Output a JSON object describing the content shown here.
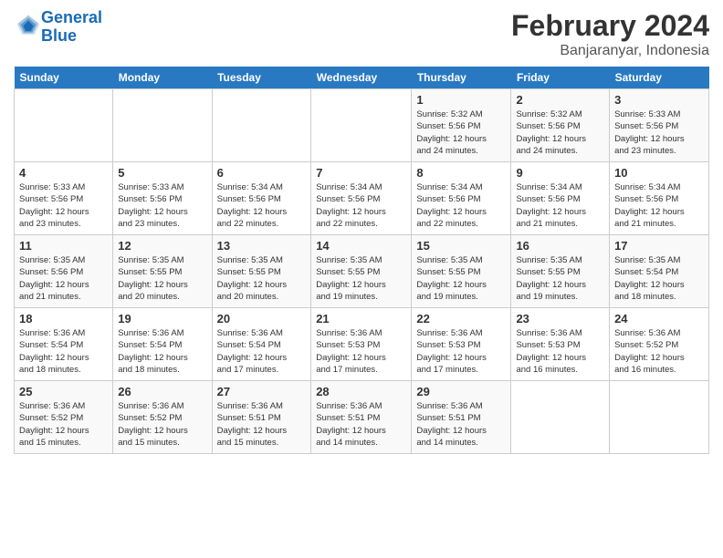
{
  "logo": {
    "text1": "General",
    "text2": "Blue"
  },
  "title": "February 2024",
  "subtitle": "Banjaranyar, Indonesia",
  "days_header": [
    "Sunday",
    "Monday",
    "Tuesday",
    "Wednesday",
    "Thursday",
    "Friday",
    "Saturday"
  ],
  "weeks": [
    [
      {
        "day": "",
        "info": ""
      },
      {
        "day": "",
        "info": ""
      },
      {
        "day": "",
        "info": ""
      },
      {
        "day": "",
        "info": ""
      },
      {
        "day": "1",
        "info": "Sunrise: 5:32 AM\nSunset: 5:56 PM\nDaylight: 12 hours\nand 24 minutes."
      },
      {
        "day": "2",
        "info": "Sunrise: 5:32 AM\nSunset: 5:56 PM\nDaylight: 12 hours\nand 24 minutes."
      },
      {
        "day": "3",
        "info": "Sunrise: 5:33 AM\nSunset: 5:56 PM\nDaylight: 12 hours\nand 23 minutes."
      }
    ],
    [
      {
        "day": "4",
        "info": "Sunrise: 5:33 AM\nSunset: 5:56 PM\nDaylight: 12 hours\nand 23 minutes."
      },
      {
        "day": "5",
        "info": "Sunrise: 5:33 AM\nSunset: 5:56 PM\nDaylight: 12 hours\nand 23 minutes."
      },
      {
        "day": "6",
        "info": "Sunrise: 5:34 AM\nSunset: 5:56 PM\nDaylight: 12 hours\nand 22 minutes."
      },
      {
        "day": "7",
        "info": "Sunrise: 5:34 AM\nSunset: 5:56 PM\nDaylight: 12 hours\nand 22 minutes."
      },
      {
        "day": "8",
        "info": "Sunrise: 5:34 AM\nSunset: 5:56 PM\nDaylight: 12 hours\nand 22 minutes."
      },
      {
        "day": "9",
        "info": "Sunrise: 5:34 AM\nSunset: 5:56 PM\nDaylight: 12 hours\nand 21 minutes."
      },
      {
        "day": "10",
        "info": "Sunrise: 5:34 AM\nSunset: 5:56 PM\nDaylight: 12 hours\nand 21 minutes."
      }
    ],
    [
      {
        "day": "11",
        "info": "Sunrise: 5:35 AM\nSunset: 5:56 PM\nDaylight: 12 hours\nand 21 minutes."
      },
      {
        "day": "12",
        "info": "Sunrise: 5:35 AM\nSunset: 5:55 PM\nDaylight: 12 hours\nand 20 minutes."
      },
      {
        "day": "13",
        "info": "Sunrise: 5:35 AM\nSunset: 5:55 PM\nDaylight: 12 hours\nand 20 minutes."
      },
      {
        "day": "14",
        "info": "Sunrise: 5:35 AM\nSunset: 5:55 PM\nDaylight: 12 hours\nand 19 minutes."
      },
      {
        "day": "15",
        "info": "Sunrise: 5:35 AM\nSunset: 5:55 PM\nDaylight: 12 hours\nand 19 minutes."
      },
      {
        "day": "16",
        "info": "Sunrise: 5:35 AM\nSunset: 5:55 PM\nDaylight: 12 hours\nand 19 minutes."
      },
      {
        "day": "17",
        "info": "Sunrise: 5:35 AM\nSunset: 5:54 PM\nDaylight: 12 hours\nand 18 minutes."
      }
    ],
    [
      {
        "day": "18",
        "info": "Sunrise: 5:36 AM\nSunset: 5:54 PM\nDaylight: 12 hours\nand 18 minutes."
      },
      {
        "day": "19",
        "info": "Sunrise: 5:36 AM\nSunset: 5:54 PM\nDaylight: 12 hours\nand 18 minutes."
      },
      {
        "day": "20",
        "info": "Sunrise: 5:36 AM\nSunset: 5:54 PM\nDaylight: 12 hours\nand 17 minutes."
      },
      {
        "day": "21",
        "info": "Sunrise: 5:36 AM\nSunset: 5:53 PM\nDaylight: 12 hours\nand 17 minutes."
      },
      {
        "day": "22",
        "info": "Sunrise: 5:36 AM\nSunset: 5:53 PM\nDaylight: 12 hours\nand 17 minutes."
      },
      {
        "day": "23",
        "info": "Sunrise: 5:36 AM\nSunset: 5:53 PM\nDaylight: 12 hours\nand 16 minutes."
      },
      {
        "day": "24",
        "info": "Sunrise: 5:36 AM\nSunset: 5:52 PM\nDaylight: 12 hours\nand 16 minutes."
      }
    ],
    [
      {
        "day": "25",
        "info": "Sunrise: 5:36 AM\nSunset: 5:52 PM\nDaylight: 12 hours\nand 15 minutes."
      },
      {
        "day": "26",
        "info": "Sunrise: 5:36 AM\nSunset: 5:52 PM\nDaylight: 12 hours\nand 15 minutes."
      },
      {
        "day": "27",
        "info": "Sunrise: 5:36 AM\nSunset: 5:51 PM\nDaylight: 12 hours\nand 15 minutes."
      },
      {
        "day": "28",
        "info": "Sunrise: 5:36 AM\nSunset: 5:51 PM\nDaylight: 12 hours\nand 14 minutes."
      },
      {
        "day": "29",
        "info": "Sunrise: 5:36 AM\nSunset: 5:51 PM\nDaylight: 12 hours\nand 14 minutes."
      },
      {
        "day": "",
        "info": ""
      },
      {
        "day": "",
        "info": ""
      }
    ]
  ]
}
